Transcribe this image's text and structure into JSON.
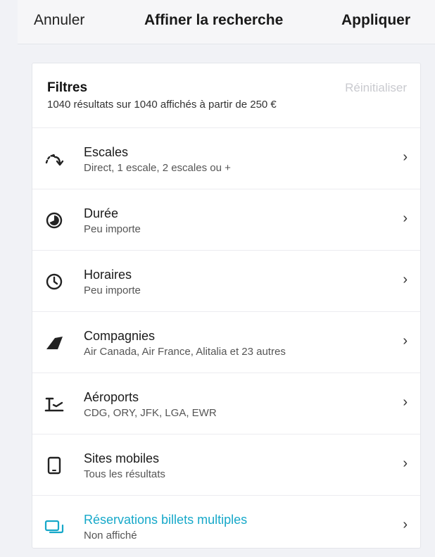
{
  "header": {
    "cancel_label": "Annuler",
    "title": "Affiner la recherche",
    "apply_label": "Appliquer"
  },
  "filters": {
    "title": "Filtres",
    "reset_label": "Réinitialiser",
    "summary": "1040 résultats sur 1040 affichés à partir de 250 €",
    "items": [
      {
        "icon": "stops-icon",
        "label": "Escales",
        "value": "Direct, 1 escale, 2 escales ou +"
      },
      {
        "icon": "duration-icon",
        "label": "Durée",
        "value": "Peu importe"
      },
      {
        "icon": "clock-icon",
        "label": "Horaires",
        "value": "Peu importe"
      },
      {
        "icon": "airline-tail-icon",
        "label": "Compagnies",
        "value": "Air Canada, Air France, Alitalia et 23 autres"
      },
      {
        "icon": "airport-icon",
        "label": "Aéroports",
        "value": "CDG, ORY, JFK, LGA, EWR"
      },
      {
        "icon": "mobile-icon",
        "label": "Sites mobiles",
        "value": "Tous les résultats"
      },
      {
        "icon": "multiple-tickets-icon",
        "label": "Réservations billets multiples",
        "value": "Non affiché"
      }
    ]
  },
  "colors": {
    "accent": "#16a8c9",
    "muted": "#c9cacf",
    "background": "#f1f2f6"
  }
}
